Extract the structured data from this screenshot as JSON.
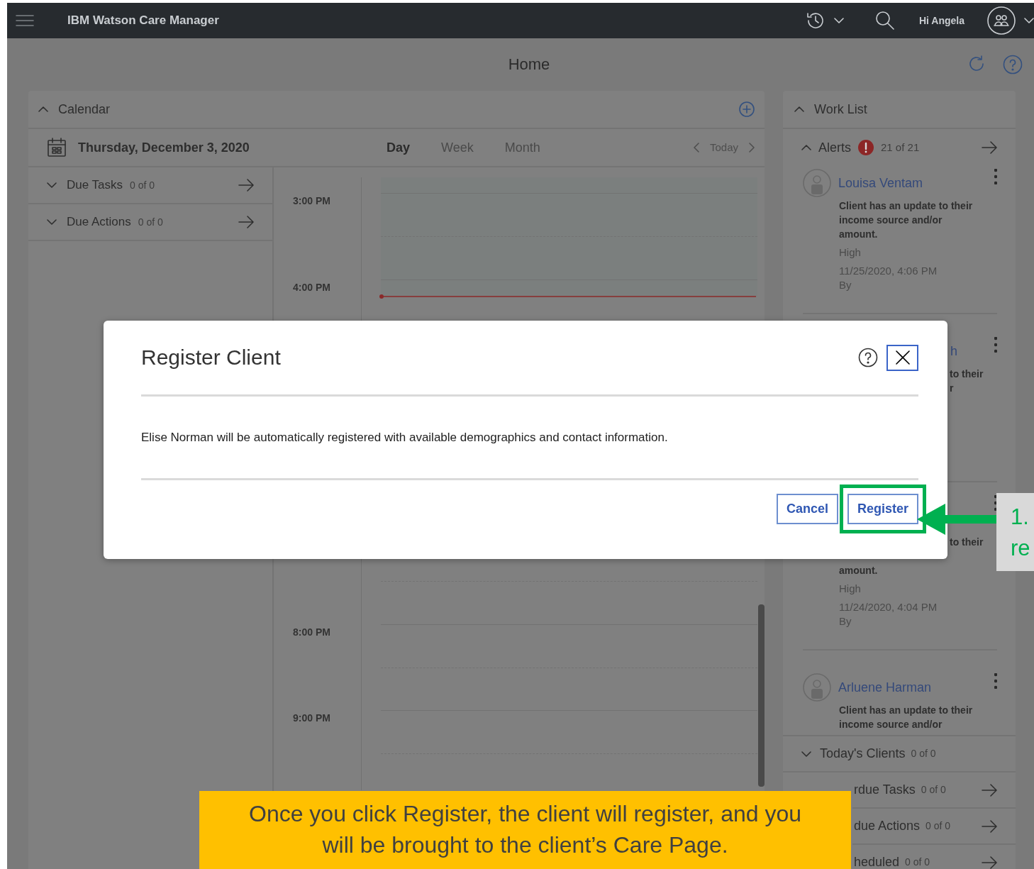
{
  "top_bar": {
    "app_name": "IBM Watson Care Manager",
    "greeting": "Hi Angela"
  },
  "page": {
    "title": "Home"
  },
  "calendar": {
    "title": "Calendar",
    "date": "Thursday, December 3, 2020",
    "views": [
      {
        "label": "Day",
        "selected": true
      },
      {
        "label": "Week",
        "selected": false
      },
      {
        "label": "Month",
        "selected": false
      }
    ],
    "today": "Today",
    "lists": [
      {
        "label": "Due Tasks",
        "count": "0 of 0"
      },
      {
        "label": "Due Actions",
        "count": "0 of 0"
      }
    ],
    "slots": [
      {
        "kind": "labeled",
        "time": "3:00 PM"
      },
      {
        "kind": "labeled",
        "time": "4:00 PM"
      },
      {
        "kind": "hidden"
      },
      {
        "kind": "hidden"
      },
      {
        "kind": "hidden"
      },
      {
        "kind": "labeled",
        "time": "8:00 PM"
      },
      {
        "kind": "labeled",
        "time": "9:00 PM"
      }
    ]
  },
  "work_list": {
    "title": "Work List",
    "alerts": {
      "label": "Alerts",
      "count": "21 of 21",
      "items": [
        {
          "name": "Louisa Ventam",
          "lines": [
            "Client has an update to their",
            "income source and/or",
            "amount."
          ],
          "priority": "High",
          "date": "11/25/2020, 4:06 PM",
          "by": "By"
        },
        {
          "name_right": "h",
          "lines_right": [
            "to their",
            "r"
          ]
        },
        {
          "lines_right": [
            "to their"
          ],
          "lines": [
            "amount."
          ],
          "priority": "High",
          "date": "11/24/2020, 4:04 PM",
          "by": "By"
        },
        {
          "name": "Arluene Harman",
          "lines": [
            "Client has an update to their",
            "income source and/or"
          ]
        }
      ]
    },
    "sections": [
      {
        "kind": "full",
        "label": "Today's Clients",
        "count": "0 of 0",
        "arrow": false
      },
      {
        "kind": "cut",
        "label": "rdue Tasks",
        "count": "0 of 0",
        "arrow": true
      },
      {
        "kind": "cut",
        "label": "due Actions",
        "count": "0 of 0",
        "arrow": true
      },
      {
        "kind": "cut",
        "label": "heduled",
        "count": "0 of 0",
        "arrow": true
      }
    ]
  },
  "dialog": {
    "title": "Register Client",
    "message": "Elise Norman will be automatically registered with available demographics and contact information.",
    "buttons": [
      {
        "label": "Cancel",
        "highlighted": false
      },
      {
        "label": "Register",
        "highlighted": true
      }
    ]
  },
  "annotations": {
    "caption": "Once you click Register, the client will register, and you will be brought to the client’s Care Page.",
    "step_lines": [
      "1.",
      "re"
    ]
  }
}
